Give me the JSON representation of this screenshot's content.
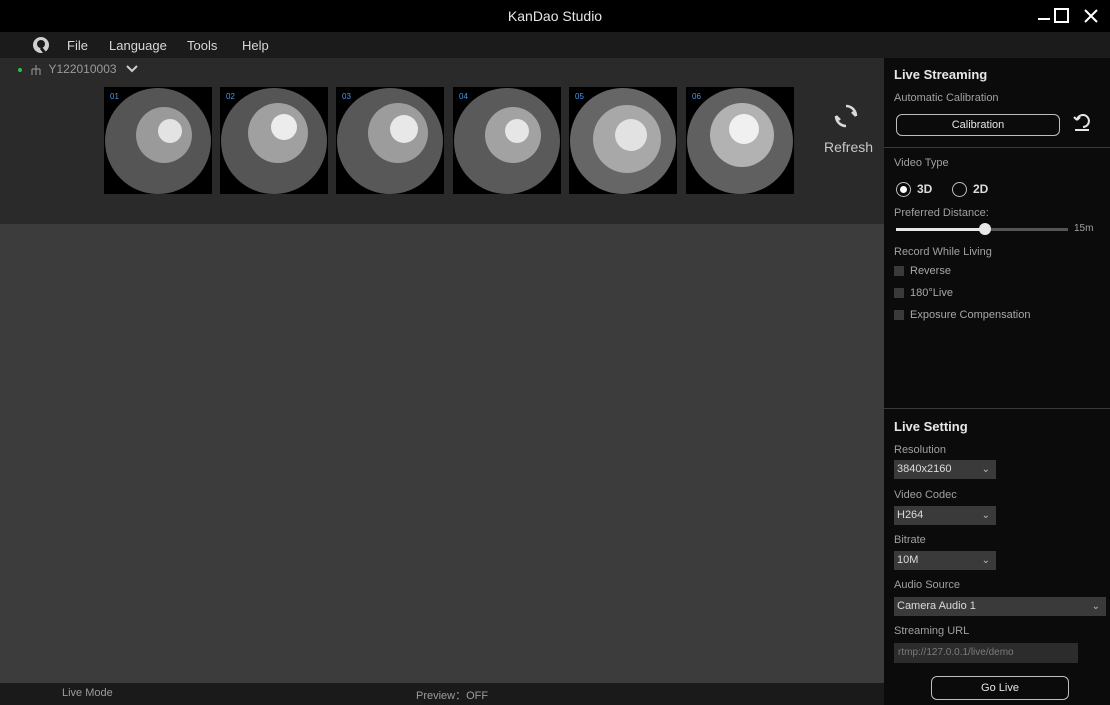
{
  "window": {
    "title": "KanDao Studio"
  },
  "menu": {
    "items": [
      "File",
      "Language",
      "Tools",
      "Help"
    ]
  },
  "device": {
    "id": "Y122010003"
  },
  "cameras": [
    "01",
    "02",
    "03",
    "04",
    "05",
    "06"
  ],
  "refresh": {
    "label": "Refresh"
  },
  "status": {
    "mode": "Live Mode",
    "preview": "Preview：OFF"
  },
  "live_streaming": {
    "title": "Live Streaming",
    "auto_calibration_label": "Automatic Calibration",
    "calibration_button": "Calibration",
    "video_type_label": "Video Type",
    "video_type_options": [
      "3D",
      "2D"
    ],
    "video_type_selected": "3D",
    "preferred_distance_label": "Preferred Distance:",
    "preferred_distance_value": "15m",
    "preferred_distance_level": 0.52,
    "record_label": "Record While Living",
    "checkboxes": [
      "Reverse",
      "180°Live",
      "Exposure Compensation"
    ]
  },
  "live_setting": {
    "title": "Live Setting",
    "resolution_label": "Resolution",
    "resolution_value": "3840x2160",
    "codec_label": "Video Codec",
    "codec_value": "H264",
    "bitrate_label": "Bitrate",
    "bitrate_value": "10M",
    "audio_label": "Audio Source",
    "audio_value": "Camera Audio 1",
    "url_label": "Streaming URL",
    "url_value": "rtmp://127.0.0.1/live/demo",
    "go_live": "Go Live"
  },
  "colors": {
    "accent_green": "#27c24c",
    "panel_bg": "#0b0b0b",
    "main_bg": "#3c3c3c"
  }
}
